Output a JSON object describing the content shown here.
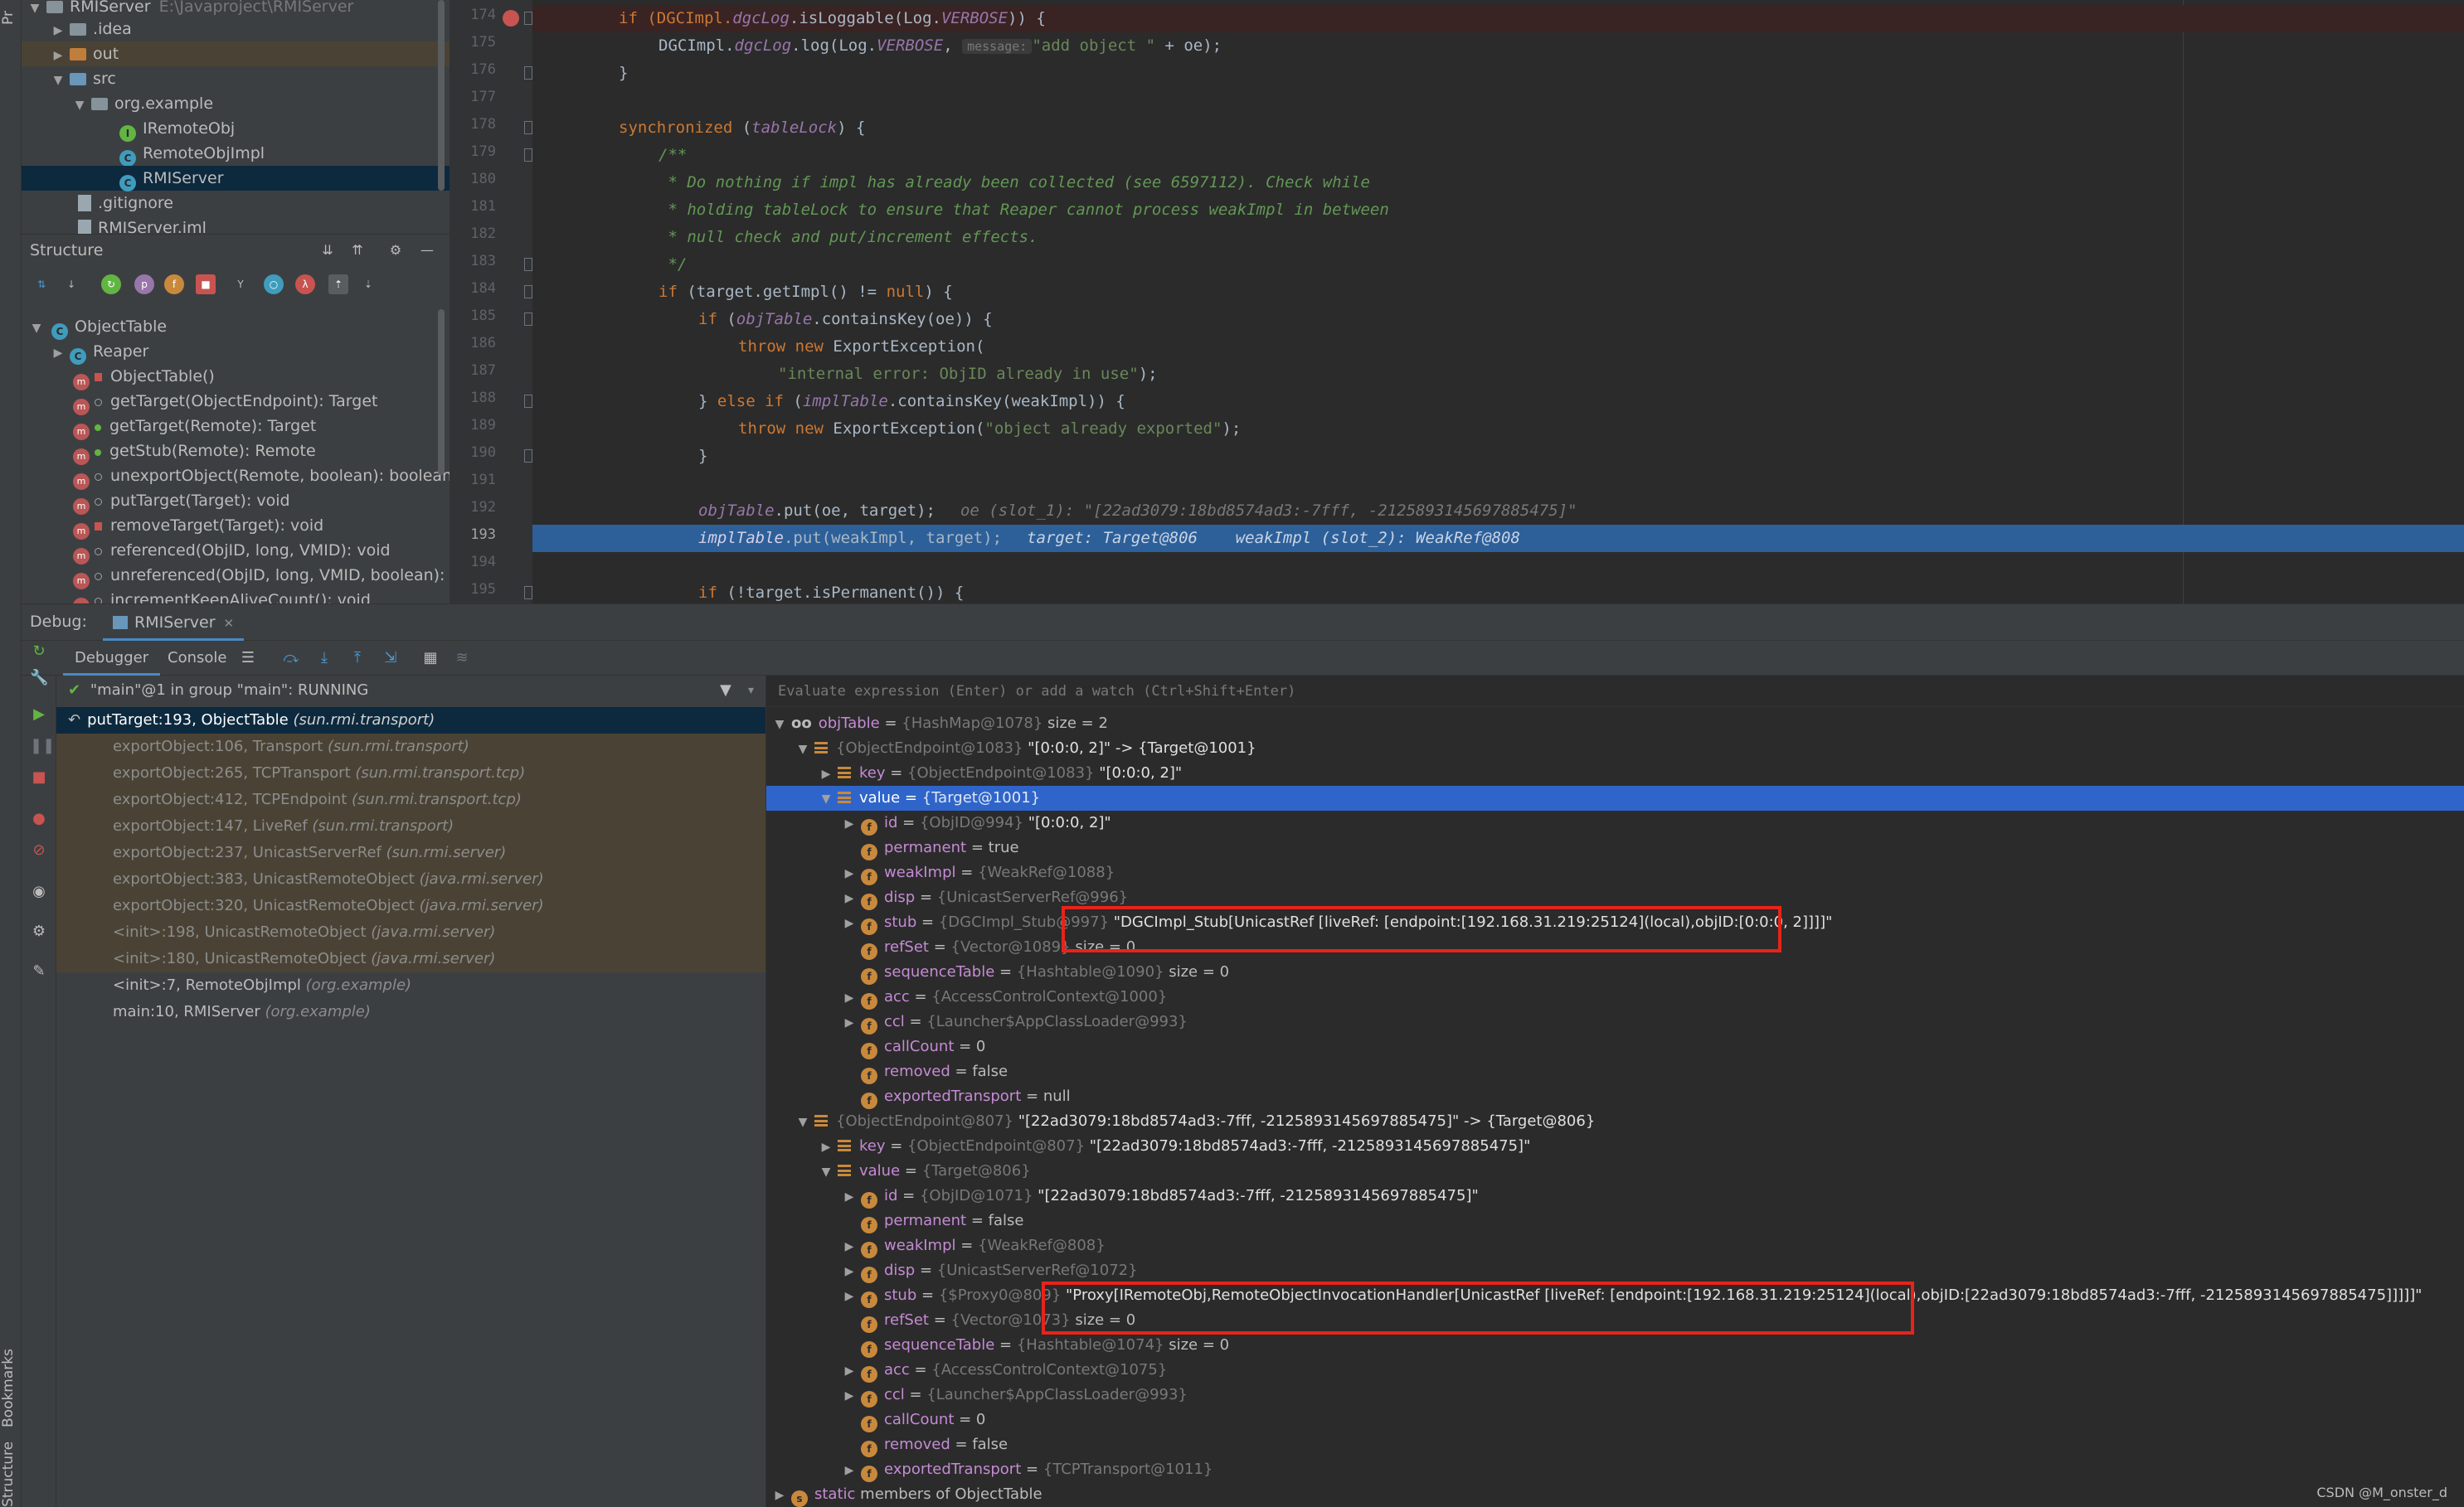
{
  "side_strip": {
    "top_label": "Pr",
    "bookmarks_label": "Bookmarks",
    "structure_label": "Structure"
  },
  "project": {
    "root_name": "RMIServer",
    "root_path": "E:\\Javaproject\\RMIServer",
    "items": [
      {
        "label": "RMIServer",
        "kind": "root"
      },
      {
        "label": ".idea",
        "kind": "folder"
      },
      {
        "label": "out",
        "kind": "folder-out"
      },
      {
        "label": "src",
        "kind": "folder-src"
      },
      {
        "label": "org.example",
        "kind": "package"
      },
      {
        "label": "IRemoteObj",
        "kind": "interface"
      },
      {
        "label": "RemoteObjImpl",
        "kind": "class"
      },
      {
        "label": "RMIServer",
        "kind": "class",
        "selected": true
      },
      {
        "label": ".gitignore",
        "kind": "file"
      },
      {
        "label": "RMIServer.iml",
        "kind": "file"
      }
    ]
  },
  "structure": {
    "title": "Structure",
    "root": "ObjectTable",
    "members": [
      {
        "label": "Reaper",
        "kind": "class"
      },
      {
        "label": "ObjectTable()",
        "kind": "method"
      },
      {
        "label": "getTarget(ObjectEndpoint): Target",
        "kind": "method"
      },
      {
        "label": "getTarget(Remote): Target",
        "kind": "method"
      },
      {
        "label": "getStub(Remote): Remote",
        "kind": "method"
      },
      {
        "label": "unexportObject(Remote, boolean): boolean",
        "kind": "method"
      },
      {
        "label": "putTarget(Target): void",
        "kind": "method"
      },
      {
        "label": "removeTarget(Target): void",
        "kind": "method"
      },
      {
        "label": "referenced(ObjID, long, VMID): void",
        "kind": "method"
      },
      {
        "label": "unreferenced(ObjID, long, VMID, boolean): voi",
        "kind": "method"
      },
      {
        "label": "incrementKeepAliveCount(): void",
        "kind": "method"
      }
    ]
  },
  "editor": {
    "line_numbers": [
      "174",
      "175",
      "176",
      "177",
      "178",
      "179",
      "180",
      "181",
      "182",
      "183",
      "184",
      "185",
      "186",
      "187",
      "188",
      "189",
      "190",
      "191",
      "192",
      "193",
      "194",
      "195"
    ],
    "current_line": "193",
    "code": {
      "l174a": "if (DGCImpl.",
      "l174b": "dgcLog",
      "l174c": ".isLoggable(Log.",
      "l174d": "VERBOSE",
      "l174e": ")) {",
      "l175a": "DGCImpl.",
      "l175b": "dgcLog",
      "l175c": ".log(Log.",
      "l175d": "VERBOSE",
      "l175e": ", ",
      "l175hint": "message:",
      "l175f": "\"add object \"",
      "l175g": " + oe);",
      "l176": "}",
      "l178a": "synchronized",
      "l178b": " (",
      "l178c": "tableLock",
      "l178d": ") {",
      "l179": "/**",
      "l180": " * Do nothing if impl has already been collected (see 6597112). Check while",
      "l181": " * holding tableLock to ensure that Reaper cannot process weakImpl in between",
      "l182": " * null check and put/increment effects.",
      "l183": " */",
      "l184a": "if",
      "l184b": " (target.getImpl() != ",
      "l184c": "null",
      "l184d": ") {",
      "l185a": "if",
      "l185b": " (",
      "l185c": "objTable",
      "l185d": ".containsKey(oe)) {",
      "l186a": "throw new",
      "l186b": " ExportException(",
      "l187": "\"internal error: ObjID already in use\"",
      "l187b": ");",
      "l188a": "} ",
      "l188b": "else if",
      "l188c": " (",
      "l188d": "implTable",
      "l188e": ".containsKey(weakImpl)) {",
      "l189a": "throw new",
      "l189b": " ExportException(",
      "l189c": "\"object already exported\"",
      "l189d": ");",
      "l190": "}",
      "l192a": "objTable",
      "l192b": ".put(oe, target);",
      "l192c": "oe (slot_1): \"[22ad3079:18bd8574ad3:-7fff, -2125893145697885475]\"",
      "l193a": "implTable",
      "l193b": ".put(weakImpl, target);",
      "l193c": "target: Target@806    weakImpl (slot_2): WeakRef@808",
      "l195a": "if",
      "l195b": " (!target.isPermanent()) {"
    }
  },
  "debug": {
    "label": "Debug:",
    "config_tab": "RMIServer",
    "tabs": [
      "Debugger",
      "Console"
    ],
    "thread": "\"main\"@1 in group \"main\": RUNNING",
    "frames": [
      {
        "method": "putTarget:193, ObjectTable",
        "pkg": "(sun.rmi.transport)",
        "kind": "current"
      },
      {
        "method": "exportObject:106, Transport",
        "pkg": "(sun.rmi.transport)",
        "kind": "lib"
      },
      {
        "method": "exportObject:265, TCPTransport",
        "pkg": "(sun.rmi.transport.tcp)",
        "kind": "lib"
      },
      {
        "method": "exportObject:412, TCPEndpoint",
        "pkg": "(sun.rmi.transport.tcp)",
        "kind": "lib"
      },
      {
        "method": "exportObject:147, LiveRef",
        "pkg": "(sun.rmi.transport)",
        "kind": "lib"
      },
      {
        "method": "exportObject:237, UnicastServerRef",
        "pkg": "(sun.rmi.server)",
        "kind": "lib"
      },
      {
        "method": "exportObject:383, UnicastRemoteObject",
        "pkg": "(java.rmi.server)",
        "kind": "lib"
      },
      {
        "method": "exportObject:320, UnicastRemoteObject",
        "pkg": "(java.rmi.server)",
        "kind": "lib"
      },
      {
        "method": "<init>:198, UnicastRemoteObject",
        "pkg": "(java.rmi.server)",
        "kind": "lib"
      },
      {
        "method": "<init>:180, UnicastRemoteObject",
        "pkg": "(java.rmi.server)",
        "kind": "lib"
      },
      {
        "method": "<init>:7, RemoteObjImpl",
        "pkg": "(org.example)",
        "kind": "user"
      },
      {
        "method": "main:10, RMIServer",
        "pkg": "(org.example)",
        "kind": "user"
      }
    ],
    "eval_placeholder": "Evaluate expression (Enter) or add a watch (Ctrl+Shift+Enter)",
    "variables": [
      {
        "indent": 0,
        "arrow": "down",
        "icon": "oo",
        "name": "objTable",
        "ref": "{HashMap@1078}",
        "val": "size = 2"
      },
      {
        "indent": 1,
        "arrow": "down",
        "icon": "list",
        "name": "",
        "ref": "{ObjectEndpoint@1083}",
        "val": "\"[0:0:0, 2]\" -> {Target@1001}"
      },
      {
        "indent": 2,
        "arrow": "right",
        "icon": "list",
        "name": "key",
        "ref": "{ObjectEndpoint@1083}",
        "val": "\"[0:0:0, 2]\""
      },
      {
        "indent": 2,
        "arrow": "down",
        "icon": "list",
        "name": "value",
        "ref": "{Target@1001}",
        "val": "",
        "selected": true
      },
      {
        "indent": 3,
        "arrow": "right",
        "icon": "f",
        "name": "id",
        "ref": "{ObjID@994}",
        "val": "\"[0:0:0, 2]\""
      },
      {
        "indent": 3,
        "arrow": "",
        "icon": "f",
        "name": "permanent",
        "ref": "",
        "val": "true"
      },
      {
        "indent": 3,
        "arrow": "right",
        "icon": "f",
        "name": "weakImpl",
        "ref": "{WeakRef@1088}",
        "val": ""
      },
      {
        "indent": 3,
        "arrow": "right",
        "icon": "f",
        "name": "disp",
        "ref": "{UnicastServerRef@996}",
        "val": ""
      },
      {
        "indent": 3,
        "arrow": "right",
        "icon": "f",
        "name": "stub",
        "ref": "{DGCImpl_Stub@997}",
        "val": "\"DGCImpl_Stub[UnicastRef [liveRef: [endpoint:[192.168.31.219:25124](local),objID:[0:0:0, 2]]]]\""
      },
      {
        "indent": 3,
        "arrow": "",
        "icon": "f",
        "name": "refSet",
        "ref": "{Vector@1089}",
        "val": "size = 0"
      },
      {
        "indent": 3,
        "arrow": "",
        "icon": "f",
        "name": "sequenceTable",
        "ref": "{Hashtable@1090}",
        "val": "size = 0"
      },
      {
        "indent": 3,
        "arrow": "right",
        "icon": "f",
        "name": "acc",
        "ref": "{AccessControlContext@1000}",
        "val": ""
      },
      {
        "indent": 3,
        "arrow": "right",
        "icon": "f",
        "name": "ccl",
        "ref": "{Launcher$AppClassLoader@993}",
        "val": ""
      },
      {
        "indent": 3,
        "arrow": "",
        "icon": "f",
        "name": "callCount",
        "ref": "",
        "val": "0"
      },
      {
        "indent": 3,
        "arrow": "",
        "icon": "f",
        "name": "removed",
        "ref": "",
        "val": "false"
      },
      {
        "indent": 3,
        "arrow": "",
        "icon": "f",
        "name": "exportedTransport",
        "ref": "",
        "val": "null"
      },
      {
        "indent": 1,
        "arrow": "down",
        "icon": "list",
        "name": "",
        "ref": "{ObjectEndpoint@807}",
        "val": "\"[22ad3079:18bd8574ad3:-7fff, -2125893145697885475]\" -> {Target@806}"
      },
      {
        "indent": 2,
        "arrow": "right",
        "icon": "list",
        "name": "key",
        "ref": "{ObjectEndpoint@807}",
        "val": "\"[22ad3079:18bd8574ad3:-7fff, -2125893145697885475]\""
      },
      {
        "indent": 2,
        "arrow": "down",
        "icon": "list",
        "name": "value",
        "ref": "{Target@806}",
        "val": ""
      },
      {
        "indent": 3,
        "arrow": "right",
        "icon": "f",
        "name": "id",
        "ref": "{ObjID@1071}",
        "val": "\"[22ad3079:18bd8574ad3:-7fff, -2125893145697885475]\""
      },
      {
        "indent": 3,
        "arrow": "",
        "icon": "f",
        "name": "permanent",
        "ref": "",
        "val": "false"
      },
      {
        "indent": 3,
        "arrow": "right",
        "icon": "f",
        "name": "weakImpl",
        "ref": "{WeakRef@808}",
        "val": ""
      },
      {
        "indent": 3,
        "arrow": "right",
        "icon": "f",
        "name": "disp",
        "ref": "{UnicastServerRef@1072}",
        "val": ""
      },
      {
        "indent": 3,
        "arrow": "right",
        "icon": "f",
        "name": "stub",
        "ref": "{$Proxy0@809}",
        "val": "\"Proxy[IRemoteObj,RemoteObjectInvocationHandler[UnicastRef [liveRef: [endpoint:[192.168.31.219:25124](local),objID:[22ad3079:18bd8574ad3:-7fff, -2125893145697885475]]]]]\""
      },
      {
        "indent": 3,
        "arrow": "",
        "icon": "f",
        "name": "refSet",
        "ref": "{Vector@1073}",
        "val": "size = 0"
      },
      {
        "indent": 3,
        "arrow": "",
        "icon": "f",
        "name": "sequenceTable",
        "ref": "{Hashtable@1074}",
        "val": "size = 0"
      },
      {
        "indent": 3,
        "arrow": "right",
        "icon": "f",
        "name": "acc",
        "ref": "{AccessControlContext@1075}",
        "val": ""
      },
      {
        "indent": 3,
        "arrow": "right",
        "icon": "f",
        "name": "ccl",
        "ref": "{Launcher$AppClassLoader@993}",
        "val": ""
      },
      {
        "indent": 3,
        "arrow": "",
        "icon": "f",
        "name": "callCount",
        "ref": "",
        "val": "0"
      },
      {
        "indent": 3,
        "arrow": "",
        "icon": "f",
        "name": "removed",
        "ref": "",
        "val": "false"
      },
      {
        "indent": 3,
        "arrow": "right",
        "icon": "f",
        "name": "exportedTransport",
        "ref": "{TCPTransport@1011}",
        "val": ""
      },
      {
        "indent": 0,
        "arrow": "right",
        "icon": "s",
        "name": "static",
        "ref": "",
        "val": "members of ObjectTable"
      }
    ]
  },
  "watermark": "CSDN @M_onster_d",
  "colors": {
    "editor_bg": "#2b2b2b",
    "panel_bg": "#3c3f41",
    "exec_line": "#2d6099",
    "selected_var": "#2f65ca",
    "annotation_red": "#e8231a",
    "keyword": "#cc7832",
    "string": "#6a8759",
    "comment": "#629755"
  }
}
